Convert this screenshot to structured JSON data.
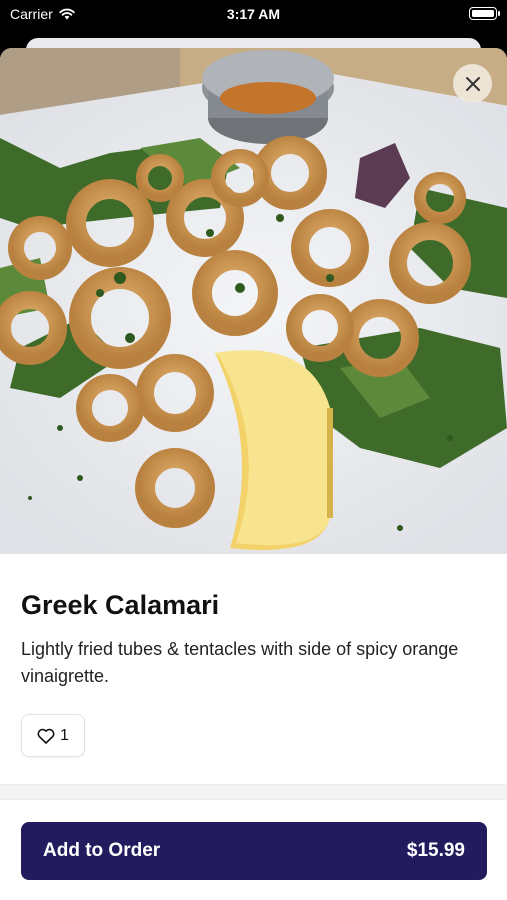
{
  "status_bar": {
    "carrier": "Carrier",
    "time": "3:17 AM"
  },
  "item": {
    "title": "Greek Calamari",
    "description": "Lightly fried tubes & tentacles with side of spicy orange vinaigrette.",
    "like_count": "1",
    "photo_alt": "Greek Calamari"
  },
  "footer": {
    "add_label": "Add to Order",
    "price": "$15.99"
  },
  "colors": {
    "accent": "#221c5e"
  },
  "icons": [
    "wifi-icon",
    "battery-icon",
    "close-icon",
    "heart-icon"
  ]
}
